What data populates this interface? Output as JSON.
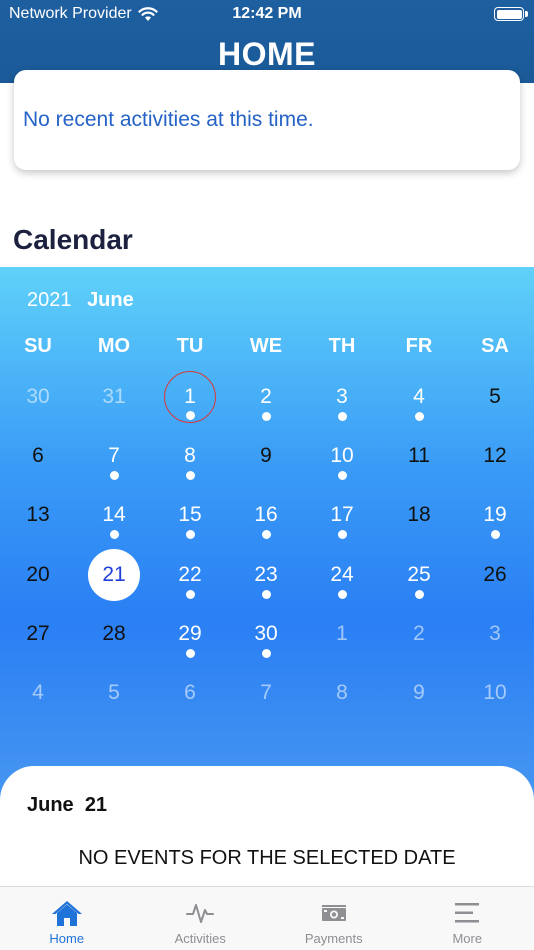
{
  "status_bar": {
    "carrier": "Network Provider",
    "time": "12:42 PM"
  },
  "header": {
    "title": "HOME"
  },
  "activities": {
    "empty_message": "No recent activities at this time."
  },
  "calendar_section": {
    "title": "Calendar"
  },
  "calendar": {
    "year": "2021",
    "month": "June",
    "weekdays": [
      "SU",
      "MO",
      "TU",
      "WE",
      "TH",
      "FR",
      "SA"
    ],
    "weeks": [
      [
        {
          "d": "30",
          "m": "other"
        },
        {
          "d": "31",
          "m": "other"
        },
        {
          "d": "1",
          "m": "cur",
          "ev": true,
          "today": true
        },
        {
          "d": "2",
          "m": "cur",
          "ev": true
        },
        {
          "d": "3",
          "m": "cur",
          "ev": true
        },
        {
          "d": "4",
          "m": "cur",
          "ev": true
        },
        {
          "d": "5",
          "m": "cur",
          "dark": true
        }
      ],
      [
        {
          "d": "6",
          "m": "cur",
          "dark": true
        },
        {
          "d": "7",
          "m": "cur",
          "ev": true
        },
        {
          "d": "8",
          "m": "cur",
          "ev": true
        },
        {
          "d": "9",
          "m": "cur",
          "dark": true
        },
        {
          "d": "10",
          "m": "cur",
          "ev": true
        },
        {
          "d": "11",
          "m": "cur",
          "dark": true
        },
        {
          "d": "12",
          "m": "cur",
          "dark": true
        }
      ],
      [
        {
          "d": "13",
          "m": "cur",
          "dark": true
        },
        {
          "d": "14",
          "m": "cur",
          "ev": true
        },
        {
          "d": "15",
          "m": "cur",
          "ev": true
        },
        {
          "d": "16",
          "m": "cur",
          "ev": true
        },
        {
          "d": "17",
          "m": "cur",
          "ev": true
        },
        {
          "d": "18",
          "m": "cur",
          "dark": true
        },
        {
          "d": "19",
          "m": "cur",
          "ev": true
        }
      ],
      [
        {
          "d": "20",
          "m": "cur",
          "dark": true
        },
        {
          "d": "21",
          "m": "cur",
          "selected": true
        },
        {
          "d": "22",
          "m": "cur",
          "ev": true
        },
        {
          "d": "23",
          "m": "cur",
          "ev": true
        },
        {
          "d": "24",
          "m": "cur",
          "ev": true
        },
        {
          "d": "25",
          "m": "cur",
          "ev": true
        },
        {
          "d": "26",
          "m": "cur",
          "dark": true
        }
      ],
      [
        {
          "d": "27",
          "m": "cur",
          "dark": true
        },
        {
          "d": "28",
          "m": "cur",
          "dark": true
        },
        {
          "d": "29",
          "m": "cur",
          "ev": true
        },
        {
          "d": "30",
          "m": "cur",
          "ev": true
        },
        {
          "d": "1",
          "m": "other"
        },
        {
          "d": "2",
          "m": "other"
        },
        {
          "d": "3",
          "m": "other"
        }
      ],
      [
        {
          "d": "4",
          "m": "other"
        },
        {
          "d": "5",
          "m": "other"
        },
        {
          "d": "6",
          "m": "other"
        },
        {
          "d": "7",
          "m": "other"
        },
        {
          "d": "8",
          "m": "other"
        },
        {
          "d": "9",
          "m": "other"
        },
        {
          "d": "10",
          "m": "other"
        }
      ]
    ]
  },
  "selected_date": {
    "month": "June",
    "day": "21",
    "empty_message": "NO EVENTS FOR THE SELECTED DATE"
  },
  "tabbar": {
    "tabs": [
      {
        "label": "Home",
        "icon": "home-icon",
        "active": true
      },
      {
        "label": "Activities",
        "icon": "pulse-icon",
        "active": false
      },
      {
        "label": "Payments",
        "icon": "cash-icon",
        "active": false
      },
      {
        "label": "More",
        "icon": "menu-icon",
        "active": false
      }
    ]
  },
  "colors": {
    "header": "#1e5fa0",
    "accent": "#1f73d8",
    "link": "#2563c6",
    "today_ring": "#d9383a"
  }
}
